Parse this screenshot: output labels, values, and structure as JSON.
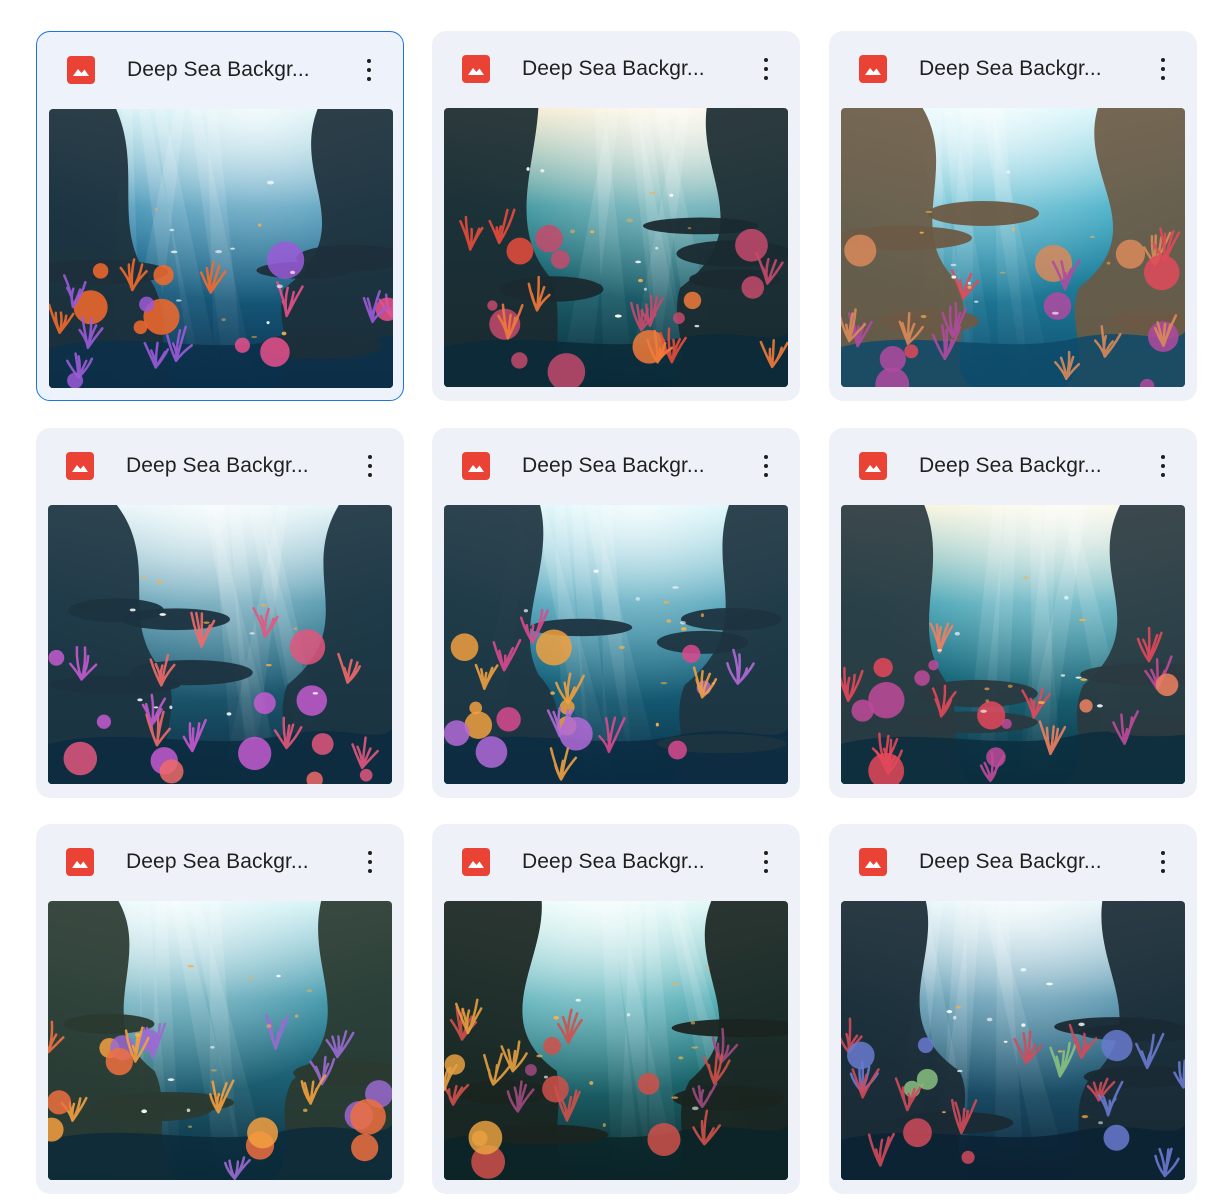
{
  "files": [
    {
      "name": "Deep Sea Backgr...",
      "selected": true,
      "palette": {
        "water": "#1f7fa8",
        "deep": "#0b2f4a",
        "light": "#bfe9ef",
        "rock": "#1c2f3a",
        "coral1": "#e8508c",
        "coral2": "#f46a2c",
        "coral3": "#9b5bd8"
      }
    },
    {
      "name": "Deep Sea Backgr...",
      "selected": false,
      "palette": {
        "water": "#2a8c96",
        "deep": "#0a2a38",
        "light": "#f4e6c0",
        "rock": "#1a2a30",
        "coral1": "#e94b3c",
        "coral2": "#f27a3a",
        "coral3": "#c54a6c"
      }
    },
    {
      "name": "Deep Sea Backgr...",
      "selected": false,
      "palette": {
        "water": "#2aa3bf",
        "deep": "#0e4a6a",
        "light": "#c8f2f8",
        "rock": "#6b5a44",
        "coral1": "#e04a5a",
        "coral2": "#d98a5a",
        "coral3": "#b04aa0"
      }
    },
    {
      "name": "Deep Sea Backgr...",
      "selected": false,
      "palette": {
        "water": "#2a7f9a",
        "deep": "#0c2c40",
        "light": "#d8f0f4",
        "rock": "#1c3340",
        "coral1": "#e2567e",
        "coral2": "#ef6a6a",
        "coral3": "#c45ad0"
      }
    },
    {
      "name": "Deep Sea Backgr...",
      "selected": false,
      "palette": {
        "water": "#1f8aa6",
        "deep": "#0a2c42",
        "light": "#c4f0f6",
        "rock": "#1e3440",
        "coral1": "#d94a8e",
        "coral2": "#f0a040",
        "coral3": "#b26ad8"
      }
    },
    {
      "name": "Deep Sea Backgr...",
      "selected": false,
      "palette": {
        "water": "#2694a8",
        "deep": "#0a2e3e",
        "light": "#f6f0d0",
        "rock": "#2a3a40",
        "coral1": "#e4485a",
        "coral2": "#f08060",
        "coral3": "#c04a9a"
      }
    },
    {
      "name": "Deep Sea Backgr...",
      "selected": false,
      "palette": {
        "water": "#2a8aa0",
        "deep": "#0b2a3a",
        "light": "#c8f0f4",
        "rock": "#2a3a30",
        "coral1": "#ef7040",
        "coral2": "#f4a040",
        "coral3": "#9a6ad0"
      }
    },
    {
      "name": "Deep Sea Backgr...",
      "selected": false,
      "palette": {
        "water": "#2a9aa4",
        "deep": "#0a2428",
        "light": "#d0f6f2",
        "rock": "#1a2420",
        "coral1": "#d0504a",
        "coral2": "#e8a040",
        "coral3": "#a04a80"
      }
    },
    {
      "name": "Deep Sea Backgr...",
      "selected": false,
      "palette": {
        "water": "#2a7898",
        "deep": "#0a2234",
        "light": "#d4eef4",
        "rock": "#1a2a34",
        "coral1": "#d04a5a",
        "coral2": "#8ac080",
        "coral3": "#6a7ad0"
      }
    }
  ]
}
